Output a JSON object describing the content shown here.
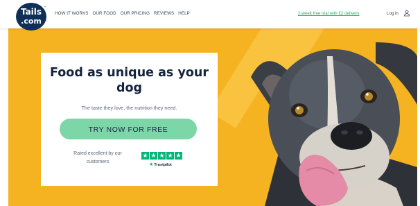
{
  "brand": {
    "logo_line1": "Tails",
    "logo_line2": ".com",
    "logo_mark": "™",
    "navy": "#0f2f57",
    "accent_green": "#7dd6a8",
    "hero_yellow": "#f6b321"
  },
  "nav": {
    "links": [
      "HOW IT WORKS",
      "OUR FOOD",
      "OUR PRICING",
      "REVIEWS",
      "HELP"
    ],
    "trial_link": "2-week free trial with £2 delivery",
    "login": "Log in",
    "user_icon": "user-icon"
  },
  "hero": {
    "headline": "Food as unique as your dog",
    "subtext": "The taste they love, the nutrition they need.",
    "cta": "TRY NOW FOR FREE",
    "rating_text": "Rated excellent by our customers",
    "trustpilot_label": "Trustpilot",
    "stars": 5,
    "star_glyph": "★",
    "trustpilot_green": "#00b67a",
    "image": "dog-photo"
  }
}
